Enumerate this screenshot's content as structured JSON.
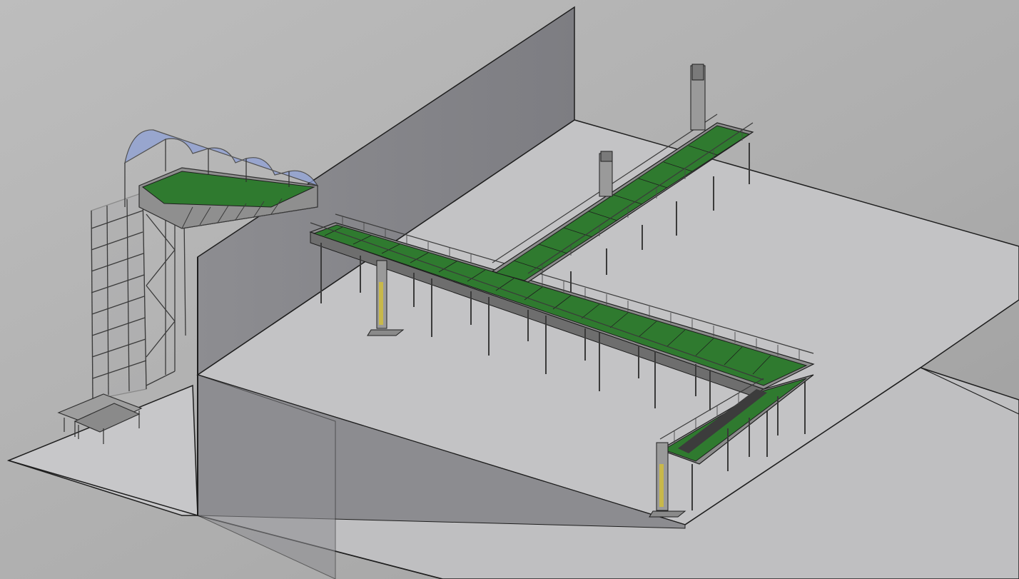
{
  "scene": {
    "kind": "isometric CAD render",
    "colors": {
      "background_light": "#bebebe",
      "background_dark": "#9b9b9b",
      "floor": "#c4c4c6",
      "floor_light": "#cfcfd1",
      "wall_front": "#8a8a8e",
      "wall_back": "#a9a9ac",
      "wall_top": "#9a9a9d",
      "edge": "#1e1e1e",
      "frame_steel": "#5a5a5a",
      "deck_green": "#2f7a2f",
      "deck_green_light": "#4aa24a",
      "railing": "#3a3a3a",
      "canopy_glass": "#8ea0d6",
      "conveyor_belt": "#3c3c3c",
      "lift_yellow": "#c8b84a"
    }
  }
}
